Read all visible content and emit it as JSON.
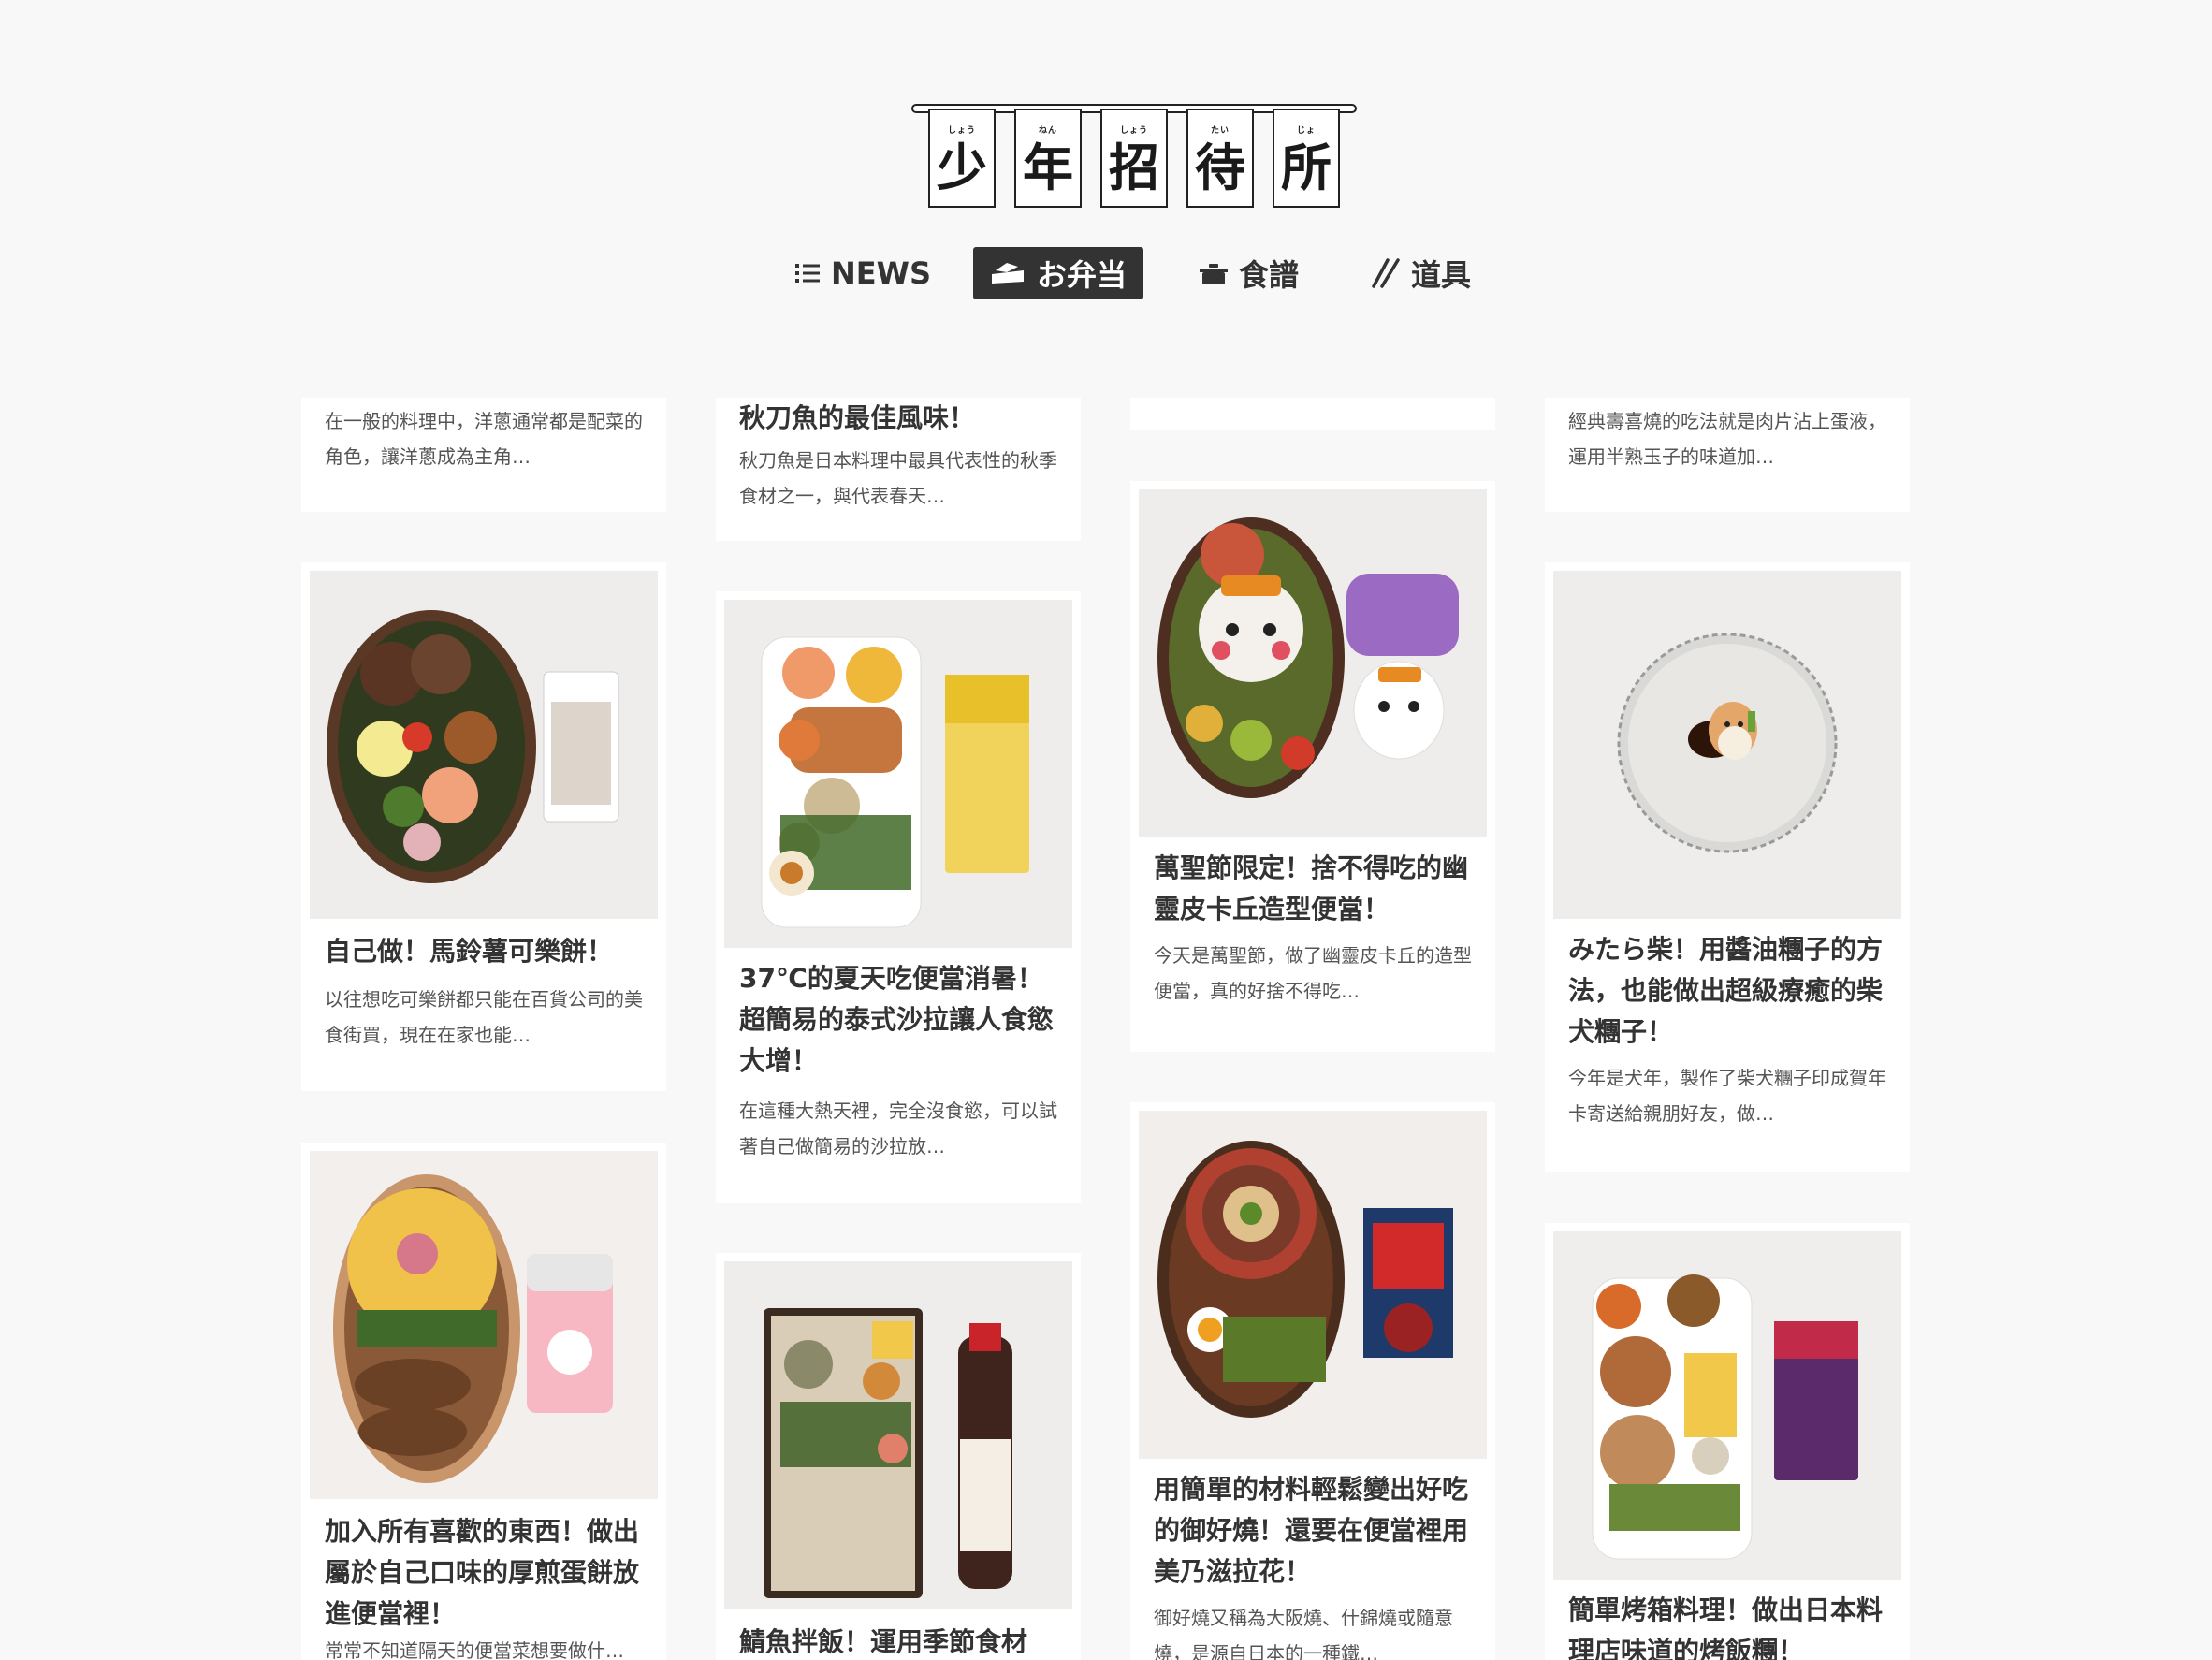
{
  "site": {
    "logo": [
      {
        "kanji": "少",
        "ruby": "しょう"
      },
      {
        "kanji": "年",
        "ruby": "ねん"
      },
      {
        "kanji": "招",
        "ruby": "しょう"
      },
      {
        "kanji": "待",
        "ruby": "たい"
      },
      {
        "kanji": "所",
        "ruby": "じょ"
      }
    ]
  },
  "nav": {
    "news": "NEWS",
    "bento": "お弁当",
    "recipe": "食譜",
    "tools": "道具",
    "active": "bento"
  },
  "columns": [
    {
      "cards": [
        {
          "excerpt": "在一般的料理中，洋蔥通常都是配菜的角色，讓洋蔥成為主角…"
        },
        {
          "title": "自己做！馬鈴薯可樂餅！",
          "excerpt": "以往想吃可樂餅都只能在百貨公司的美食街買，現在在家也能…",
          "image": "bento-croquette"
        },
        {
          "title": "加入所有喜歡的東西！做出屬於自己口味的厚煎蛋餅放進便當裡！",
          "excerpt": "常常不知道隔天的便當菜想要做什…",
          "image": "bento-omelette"
        }
      ]
    },
    {
      "cards": [
        {
          "title": "秋刀魚的最佳風味！",
          "excerpt": "秋刀魚是日本料理中最具代表性的秋季食材之一，與代表春天…"
        },
        {
          "title": "37℃的夏天吃便當消暑！超簡易的泰式沙拉讓人食慾大增！",
          "excerpt": "在這種大熱天裡，完全沒食慾，可以試著自己做簡易的沙拉放…",
          "image": "bento-thai-salad"
        },
        {
          "title": "鯖魚拌飯！運用季節食材",
          "image": "bento-mackerel-rice"
        }
      ]
    },
    {
      "cards": [
        {
          "title": "萬聖節限定！捨不得吃的幽靈皮卡丘造型便當！",
          "excerpt": "今天是萬聖節，做了幽靈皮卡丘的造型便當，真的好捨不得吃…",
          "image": "bento-pikachu"
        },
        {
          "title": "用簡單的材料輕鬆變出好吃的御好燒！還要在便當裡用美乃滋拉花！",
          "excerpt": "御好燒又稱為大阪燒、什錦燒或隨意燒，是源自日本的一種鐵…",
          "image": "bento-okonomiyaki"
        }
      ]
    },
    {
      "cards": [
        {
          "excerpt": "經典壽喜燒的吃法就是肉片沾上蛋液，運用半熟玉子的味道加…"
        },
        {
          "title": "みたら柴！用醬油糰子的方法，也能做出超級療癒的柴犬糰子！",
          "excerpt": "今年是犬年，製作了柴犬糰子印成賀年卡寄送給親朋好友，做…",
          "image": "shiba-dango"
        },
        {
          "title": "簡單烤箱料理！做出日本料理店味道的烤飯糰！",
          "image": "bento-grilled-onigiri"
        }
      ]
    }
  ]
}
